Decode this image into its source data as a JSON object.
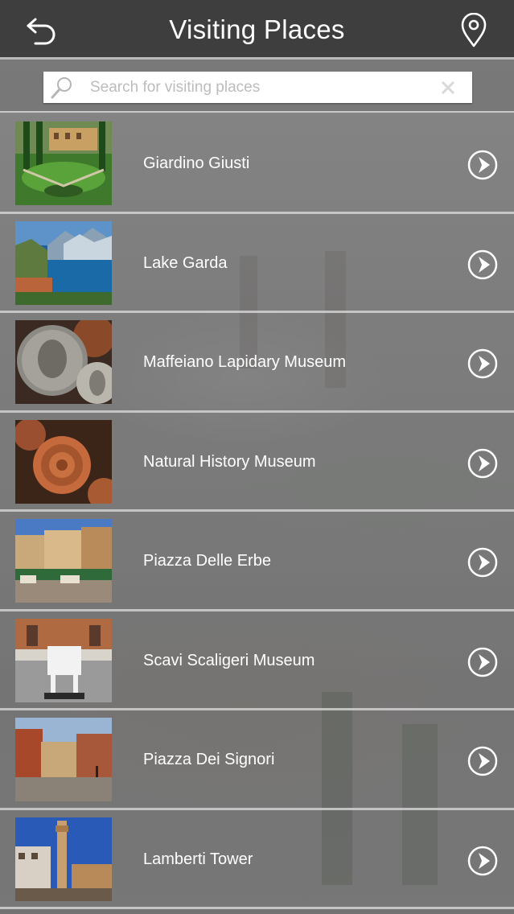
{
  "header": {
    "title": "Visiting Places",
    "back_icon": "back-arrow-icon",
    "map_icon": "map-pin-icon"
  },
  "search": {
    "placeholder": "Search for visiting places",
    "value": ""
  },
  "places": [
    {
      "name": "Giardino Giusti",
      "thumb": "garden"
    },
    {
      "name": "Lake Garda",
      "thumb": "lake"
    },
    {
      "name": "Maffeiano Lapidary Museum",
      "thumb": "coins"
    },
    {
      "name": "Natural History Museum",
      "thumb": "fossil"
    },
    {
      "name": "Piazza Delle Erbe",
      "thumb": "market-square"
    },
    {
      "name": "Scavi Scaligeri Museum",
      "thumb": "sculpture"
    },
    {
      "name": "Piazza Dei Signori",
      "thumb": "plaza"
    },
    {
      "name": "Lamberti Tower",
      "thumb": "tower"
    }
  ],
  "colors": {
    "header_bg": "#3e3e3e",
    "row_text": "#ffffff",
    "divider": "#d7d7d7"
  }
}
